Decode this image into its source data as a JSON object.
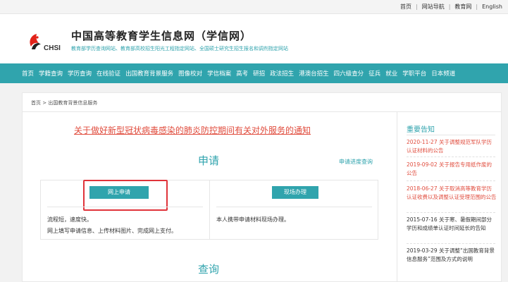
{
  "topbar": {
    "links": [
      "首页",
      "网站导航",
      "教育网",
      "English"
    ],
    "separators": [
      "|",
      "|",
      "|"
    ]
  },
  "header": {
    "logo_text": "CHSI",
    "title": "中国高等教育学生信息网（学信网）",
    "subtitle": "教育部学历查询网站、教育部高校招生阳光工程指定网站、全国硕士研究生招生报名和调剂指定网站",
    "logo_colors": {
      "red": "#e2231a",
      "black": "#222222"
    }
  },
  "nav": {
    "items": [
      "首页",
      "学籍查询",
      "学历查询",
      "在线验证",
      "出国教育背景服务",
      "图像校对",
      "学信档案",
      "高考",
      "研招",
      "政法招生",
      "港澳台招生",
      "四六级查分",
      "征兵",
      "就业",
      "学职平台",
      "日本频道"
    ]
  },
  "breadcrumb": "首页 > 出国教育背景信息服务",
  "notice": "关于做好新型冠状病毒感染的肺炎防控期间有关对外服务的通知",
  "apply": {
    "heading": "申请",
    "progress_link": "申请进度查询",
    "online_button": "网上申请",
    "onsite_button": "现场办理",
    "online_desc_1": "流程短，速度快。",
    "online_desc_2": "网上填写申请信息、上传材料图片、完成网上支付。",
    "onsite_desc": "本人携带申请材料现场办理。"
  },
  "query": {
    "heading": "查询"
  },
  "sidebar": {
    "title": "重要告知",
    "items": [
      {
        "text": "2020-11-27 关于调整规范军队学历认证材料的公告",
        "color": "red"
      },
      {
        "text": "2019-09-02 关于报告专用纸作废的公告",
        "color": "red"
      },
      {
        "text": "2018-06-27 关于取消高等教育学历认证收费以及调整认证受理范围的公告",
        "color": "red"
      },
      {
        "text": "2015-07-16 关于寒、暑假期间部分学历和成绩单认证时间延长的告知",
        "color": "gray"
      },
      {
        "text": "2019-03-29 关于调整“出国教育背景信息服务”范围及方式的说明",
        "color": "gray"
      }
    ]
  },
  "colors": {
    "accent": "#30a4ad",
    "notice_red": "#e04b3c",
    "highlight_box": "#e0333a"
  }
}
